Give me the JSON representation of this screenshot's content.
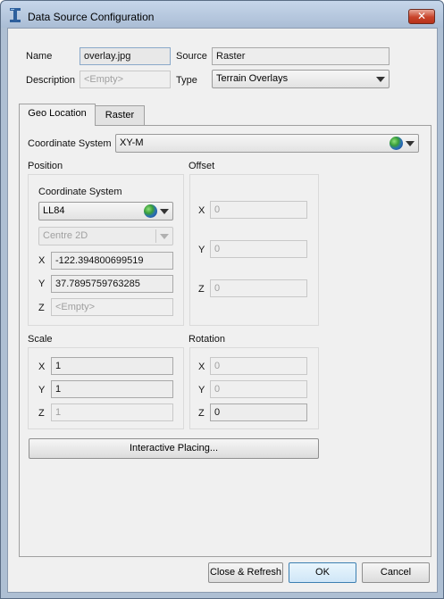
{
  "window": {
    "title": "Data Source Configuration",
    "close_glyph": "✕"
  },
  "header": {
    "name_label": "Name",
    "name_value": "overlay.jpg",
    "source_label": "Source",
    "source_value": "Raster",
    "description_label": "Description",
    "description_placeholder": "<Empty>",
    "type_label": "Type",
    "type_value": "Terrain Overlays"
  },
  "tabs": [
    {
      "label": "Geo Location"
    },
    {
      "label": "Raster"
    }
  ],
  "geo": {
    "cs_label": "Coordinate System",
    "cs_value": "XY-M",
    "position": {
      "title": "Position",
      "cs_label": "Coordinate System",
      "cs_value": "LL84",
      "mode_value": "Centre 2D",
      "x_label": "X",
      "x_value": "-122.394800699519",
      "y_label": "Y",
      "y_value": "37.7895759763285",
      "z_label": "Z",
      "z_placeholder": "<Empty>"
    },
    "offset": {
      "title": "Offset",
      "x_label": "X",
      "x_value": "0",
      "y_label": "Y",
      "y_value": "0",
      "z_label": "Z",
      "z_value": "0"
    },
    "scale": {
      "title": "Scale",
      "x_label": "X",
      "x_value": "1",
      "y_label": "Y",
      "y_value": "1",
      "z_label": "Z",
      "z_value": "1"
    },
    "rotation": {
      "title": "Rotation",
      "x_label": "X",
      "x_value": "0",
      "y_label": "Y",
      "y_value": "0",
      "z_label": "Z",
      "z_value": "0"
    },
    "interactive_label": "Interactive Placing..."
  },
  "footer": {
    "close_refresh_label": "Close & Refresh",
    "ok_label": "OK",
    "cancel_label": "Cancel"
  },
  "icons": {
    "app": "app-logo-icon",
    "globe": "globe-icon",
    "dropdown": "chevron-down-icon"
  },
  "colors": {
    "titlebar": "#aabdd5",
    "close": "#c8432a",
    "default_button_border": "#3c7fb1"
  }
}
